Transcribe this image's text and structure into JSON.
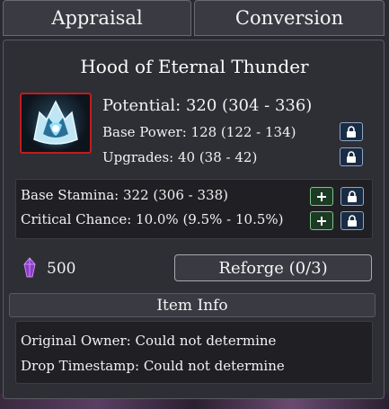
{
  "tabs": {
    "appraisal": "Appraisal",
    "conversion": "Conversion"
  },
  "item": {
    "name": "Hood of Eternal Thunder",
    "icon": "thunder-hood-icon",
    "potential": "Potential: 320 (304 - 336)",
    "base_power": "Base Power: 128 (122 - 134)",
    "upgrades": "Upgrades: 40 (38 - 42)"
  },
  "bonus_stats": [
    {
      "label": "Base Stamina: 322 (306 - 338)"
    },
    {
      "label": "Critical Chance: 10.0% (9.5% - 10.5%)"
    }
  ],
  "currency": {
    "icon": "purple-crystal-icon",
    "amount": "500"
  },
  "reforge": {
    "label": "Reforge (0/3)"
  },
  "item_info": {
    "header": "Item Info",
    "original_owner": "Original Owner: Could not determine",
    "drop_timestamp": "Drop Timestamp: Could not determine"
  },
  "colors": {
    "panel_bg": "#2e2e35",
    "icon_border": "#c21c1c",
    "lock_border": "#8ea6c6",
    "plus_border": "#7fc48a",
    "gem": "#8a3cc8"
  }
}
